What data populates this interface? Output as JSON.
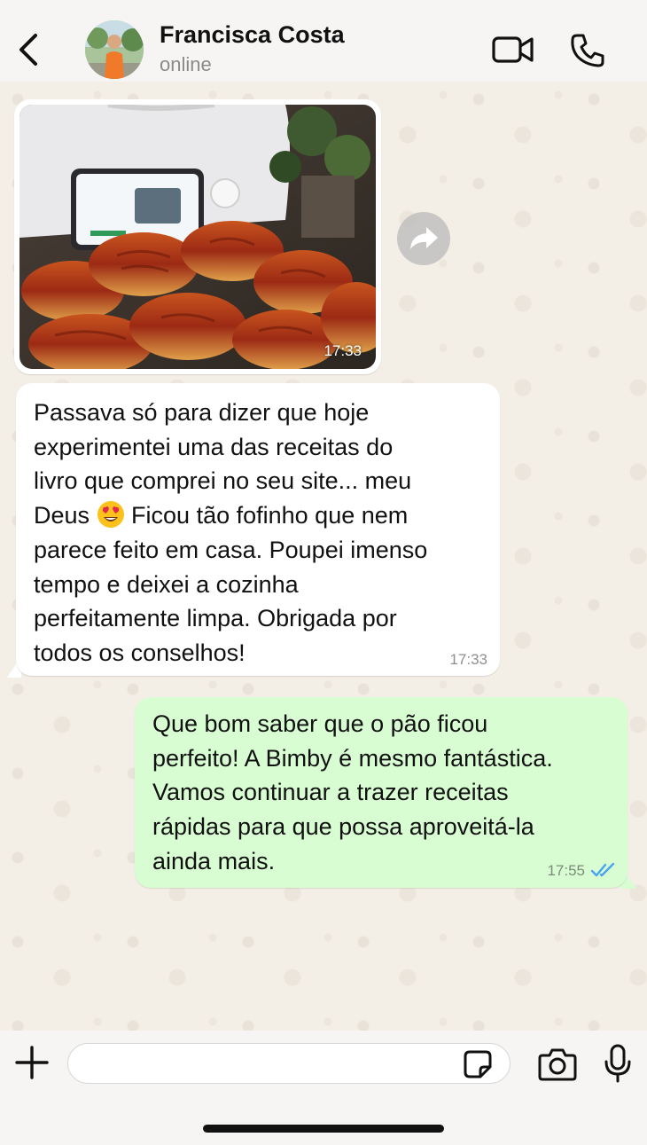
{
  "header": {
    "contact_name": "Francisca Costa",
    "status": "online"
  },
  "messages": [
    {
      "type": "image",
      "direction": "incoming",
      "time": "17:33"
    },
    {
      "type": "text",
      "direction": "incoming",
      "text_before_emoji": "Passava só para dizer que hoje\nexperimentei uma das receitas do\nlivro que comprei no seu site... meu\nDeus ",
      "emoji": "smiling-face-with-heart-eyes",
      "text_after_emoji": " Ficou tão fofinho que nem\nparece feito em casa. Poupei imenso\ntempo e deixei a cozinha\nperfeitamente limpa. Obrigada por\ntodos os conselhos!",
      "time": "17:33"
    },
    {
      "type": "text",
      "direction": "outgoing",
      "text": "Que bom saber que o pão ficou\nperfeito! A Bimby é mesmo fantástica.\nVamos continuar a trazer receitas\nrápidas para que possa aproveitá-la\nainda mais.",
      "time": "17:55",
      "status": "read"
    }
  ],
  "composer": {
    "value": ""
  },
  "colors": {
    "outgoing_bubble": "#d9fdd3",
    "incoming_bubble": "#ffffff",
    "read_ticks": "#4aa3f0",
    "chat_background": "#f4efe6"
  },
  "icons": {
    "back": "chevron-left-icon",
    "video": "video-camera-icon",
    "call": "phone-icon",
    "forward": "forward-arrow-icon",
    "plus": "plus-icon",
    "sticker": "sticker-icon",
    "camera": "camera-icon",
    "mic": "microphone-icon",
    "ticks": "double-check-icon"
  }
}
